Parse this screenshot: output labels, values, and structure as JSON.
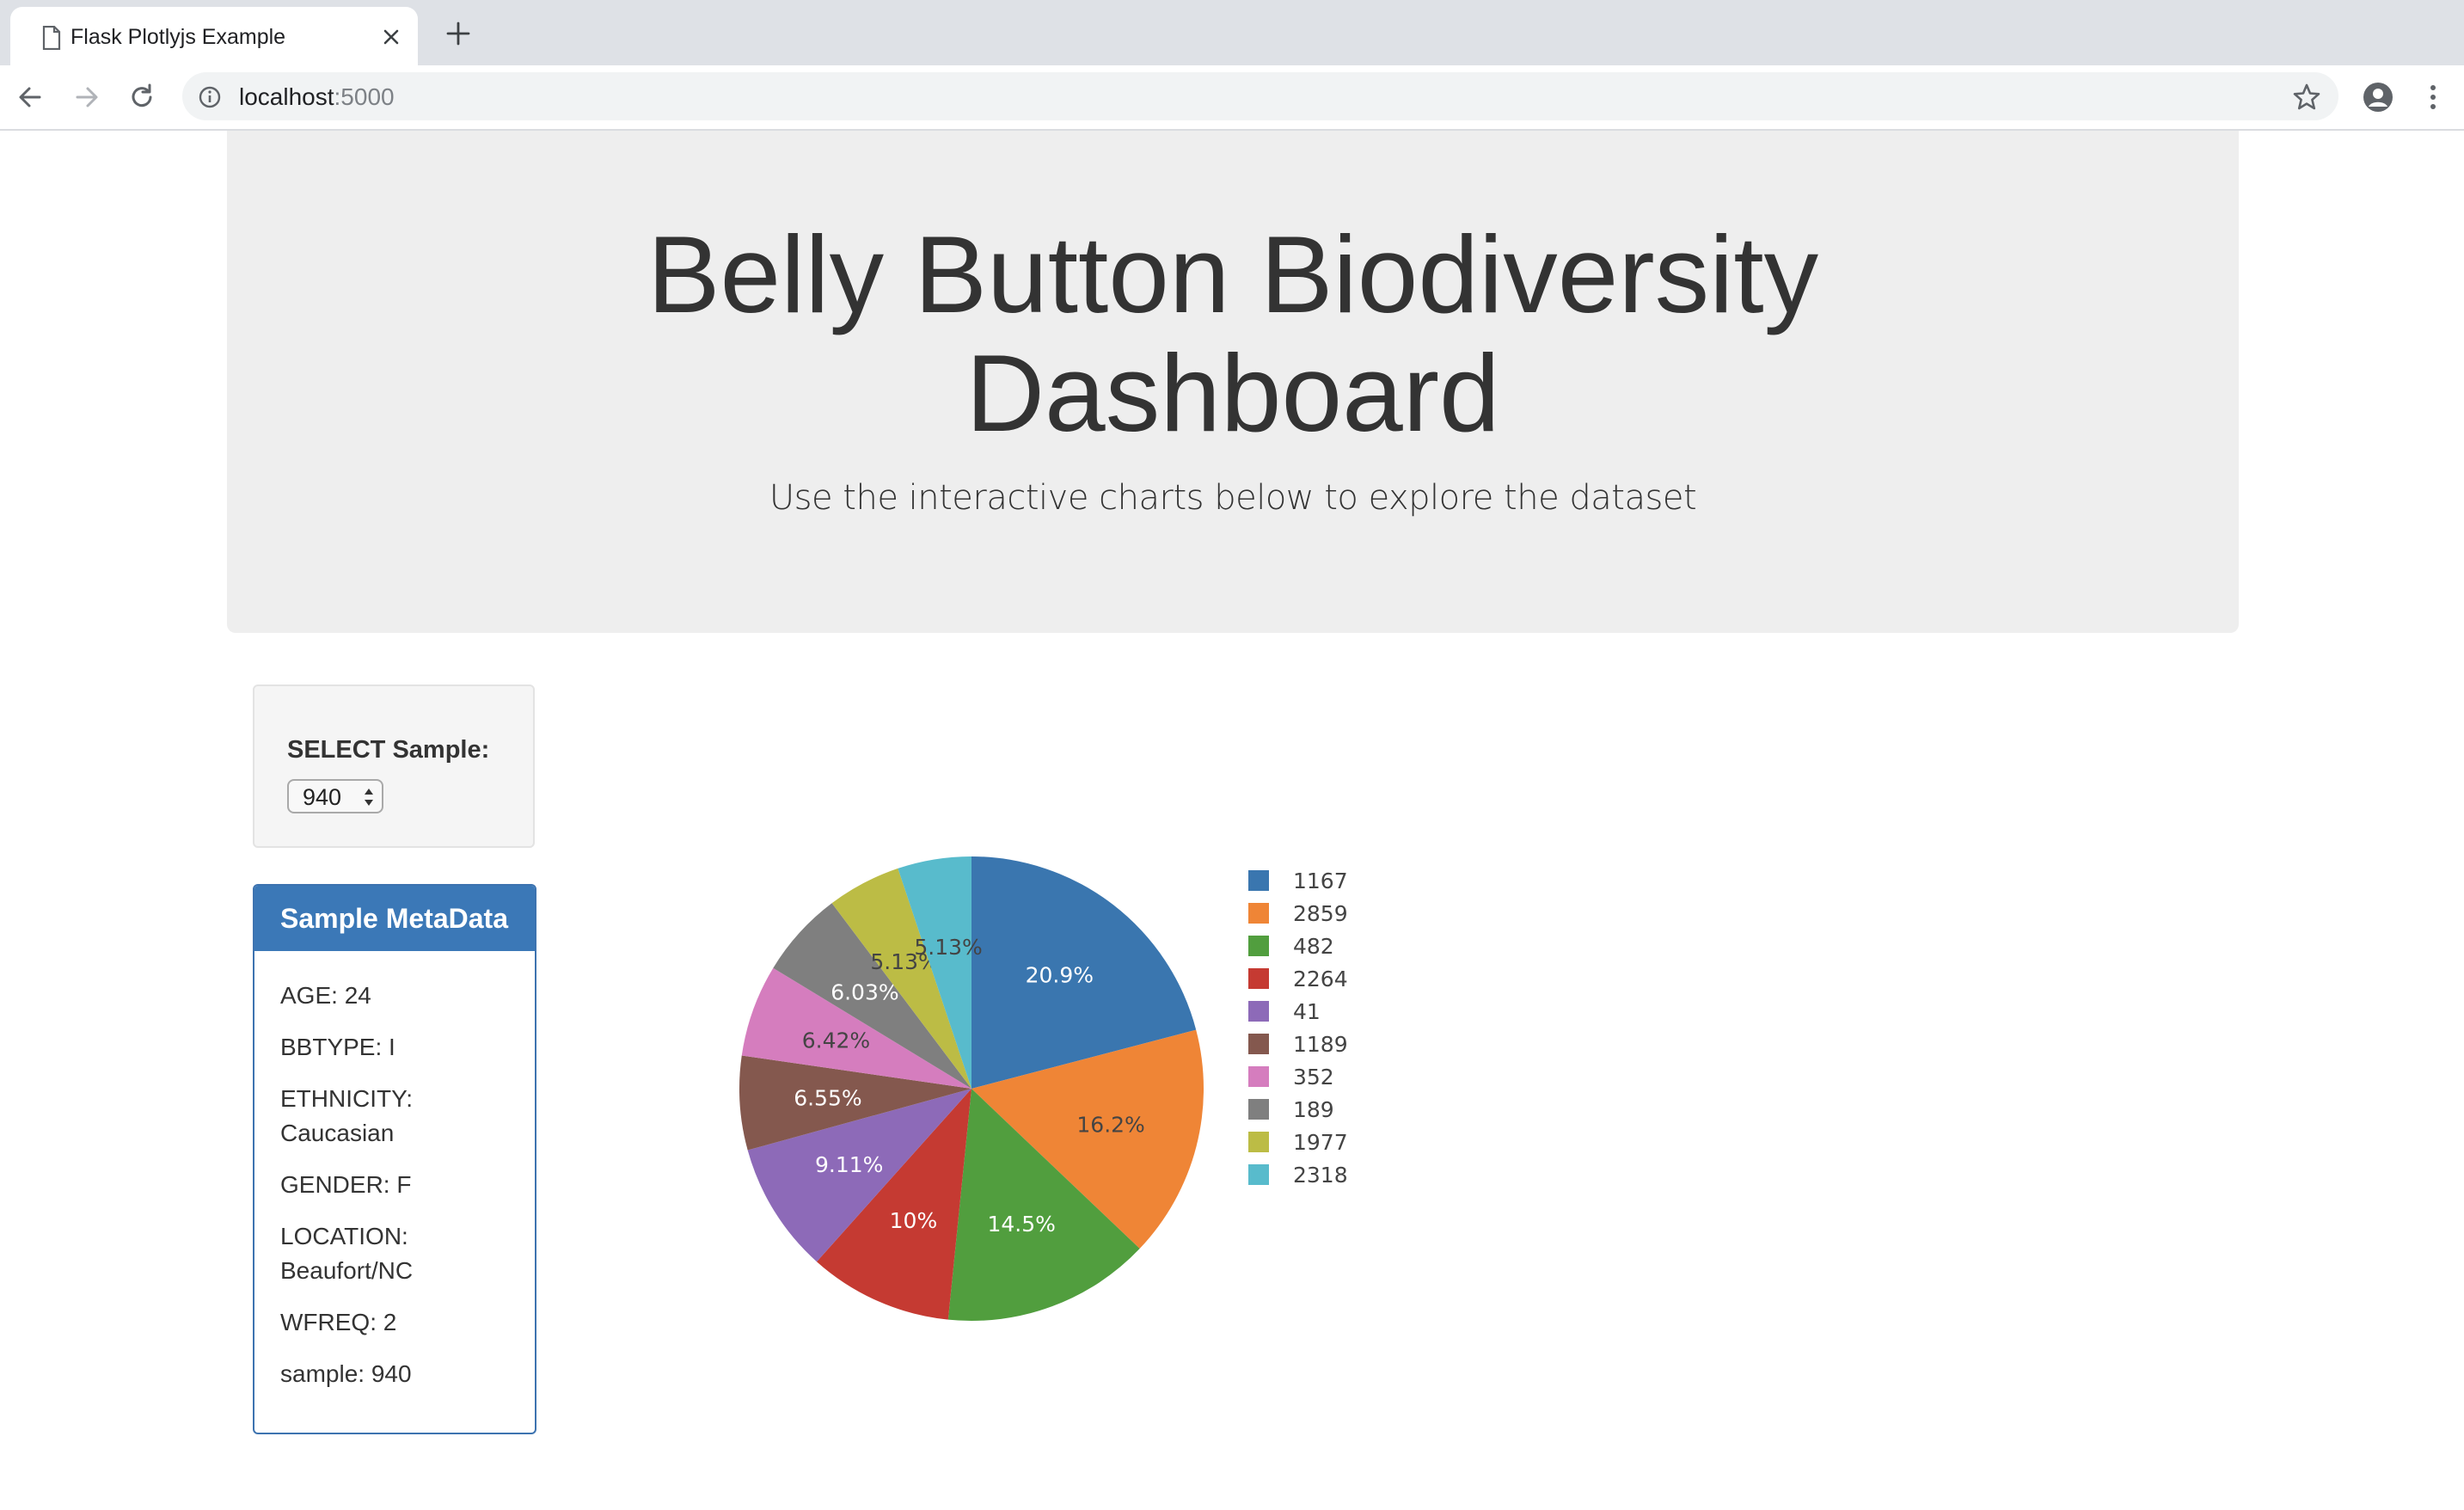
{
  "browser": {
    "tab_title": "Flask Plotlyjs Example",
    "url_host": "localhost",
    "url_port": ":5000"
  },
  "header": {
    "title_line1": "Belly Button Biodiversity",
    "title_line2": "Dashboard",
    "subtitle": "Use the interactive charts below to explore the dataset"
  },
  "selector": {
    "label": "SELECT Sample:",
    "selected": "940"
  },
  "metadata": {
    "heading": "Sample MetaData",
    "items": [
      "AGE: 24",
      "BBTYPE: I",
      "ETHNICITY: Caucasian",
      "GENDER: F",
      "LOCATION: Beaufort/NC",
      "WFREQ: 2",
      "sample: 940"
    ]
  },
  "chart_data": {
    "type": "pie",
    "labels": [
      "1167",
      "2859",
      "482",
      "2264",
      "41",
      "1189",
      "352",
      "189",
      "1977",
      "2318"
    ],
    "values": [
      163,
      126,
      113,
      78,
      71,
      51,
      50,
      47,
      40,
      40
    ],
    "percent_labels": [
      "20.9%",
      "16.2%",
      "14.5%",
      "10%",
      "9.11%",
      "6.55%",
      "6.42%",
      "6.03%",
      "5.13%",
      "5.13%"
    ],
    "colors": [
      "#3a76af",
      "#ef8536",
      "#519e3e",
      "#c53a32",
      "#8d6ab8",
      "#84584e",
      "#d57dbe",
      "#7f7f7f",
      "#bcbc45",
      "#58bbcc"
    ],
    "label_colors": [
      "#ffffff",
      "#444444",
      "#ffffff",
      "#ffffff",
      "#ffffff",
      "#ffffff",
      "#444444",
      "#ffffff",
      "#444444",
      "#444444"
    ],
    "legend_position": "right"
  }
}
